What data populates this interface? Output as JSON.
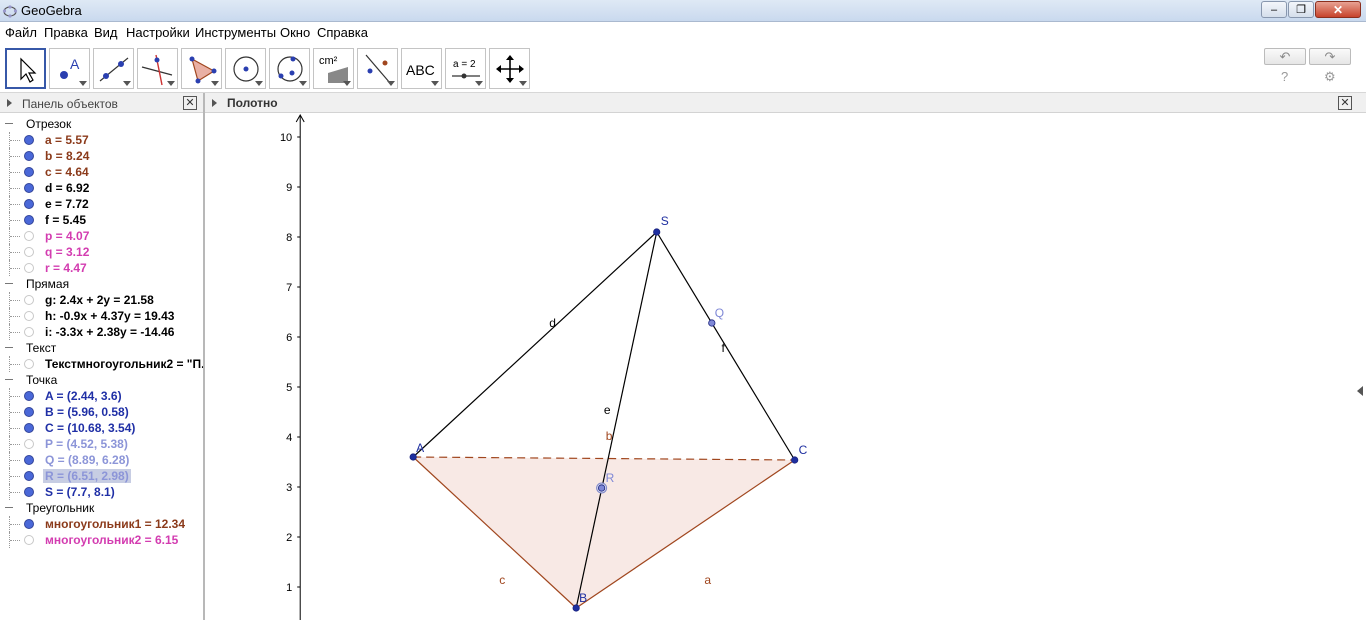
{
  "window": {
    "title": "GeoGebra",
    "controls": {
      "minimize": "–",
      "maximize": "❐",
      "close": "✕"
    }
  },
  "menu": [
    "Файл",
    "Правка",
    "Вид",
    "Настройки",
    "Инструменты",
    "Окно",
    "Справка"
  ],
  "toolbar": {
    "tools": [
      {
        "name": "move-tool",
        "icon": "arrow-pointer-icon",
        "selected": true
      },
      {
        "name": "point-tool",
        "icon": "point-icon",
        "label": "A"
      },
      {
        "name": "line-tool",
        "icon": "line-through-points-icon"
      },
      {
        "name": "perpendicular-tool",
        "icon": "perpendicular-line-icon"
      },
      {
        "name": "polygon-tool",
        "icon": "polygon-icon"
      },
      {
        "name": "circle-tool",
        "icon": "circle-center-point-icon"
      },
      {
        "name": "conic-tool",
        "icon": "circle-three-points-icon"
      },
      {
        "name": "measure-tool",
        "icon": "area-icon",
        "label": "cm²"
      },
      {
        "name": "reflect-tool",
        "icon": "reflect-line-icon"
      },
      {
        "name": "text-tool",
        "icon": "text-icon",
        "label": "ABC"
      },
      {
        "name": "slider-tool",
        "icon": "slider-icon",
        "label": "a = 2"
      },
      {
        "name": "move-view-tool",
        "icon": "move-graphics-view-icon"
      }
    ],
    "undo": "↶",
    "redo": "↷",
    "help": "?",
    "settings": "⚙"
  },
  "algebra_view": {
    "title": "Панель объектов",
    "close": "✕",
    "categories": [
      {
        "label": "Отрезок",
        "items": [
          {
            "text": "a = 5.57",
            "color": "#8b3a1a",
            "visible": true
          },
          {
            "text": "b = 8.24",
            "color": "#8b3a1a",
            "visible": true
          },
          {
            "text": "c = 4.64",
            "color": "#8b3a1a",
            "visible": true
          },
          {
            "text": "d = 6.92",
            "color": "#000000",
            "visible": true
          },
          {
            "text": "e = 7.72",
            "color": "#000000",
            "visible": true
          },
          {
            "text": "f = 5.45",
            "color": "#000000",
            "visible": true
          },
          {
            "text": "p = 4.07",
            "color": "#d33cb0",
            "visible": false
          },
          {
            "text": "q = 3.12",
            "color": "#d33cb0",
            "visible": false
          },
          {
            "text": "r = 4.47",
            "color": "#d33cb0",
            "visible": false
          }
        ]
      },
      {
        "label": "Прямая",
        "items": [
          {
            "text": "g: 2.4x + 2y = 21.58",
            "color": "#000000",
            "visible": false
          },
          {
            "text": "h: -0.9x + 4.37y = 19.43",
            "color": "#000000",
            "visible": false
          },
          {
            "text": "i: -3.3x + 2.38y = -14.46",
            "color": "#000000",
            "visible": false
          }
        ]
      },
      {
        "label": "Текст",
        "items": [
          {
            "text": "Текстмногоугольник2 = \"П...",
            "color": "#000000",
            "visible": false
          }
        ]
      },
      {
        "label": "Точка",
        "items": [
          {
            "text": "A = (2.44, 3.6)",
            "color": "#1f2fa6",
            "visible": true
          },
          {
            "text": "B = (5.96, 0.58)",
            "color": "#1f2fa6",
            "visible": true
          },
          {
            "text": "C = (10.68, 3.54)",
            "color": "#1f2fa6",
            "visible": true
          },
          {
            "text": "P = (4.52, 5.38)",
            "color": "#8c95d8",
            "visible": false
          },
          {
            "text": "Q = (8.89, 6.28)",
            "color": "#8c95d8",
            "visible": true
          },
          {
            "text": "R = (6.51, 2.98)",
            "color": "#8c95d8",
            "visible": true,
            "highlighted": true
          },
          {
            "text": "S = (7.7, 8.1)",
            "color": "#1f2fa6",
            "visible": true
          }
        ]
      },
      {
        "label": "Треугольник",
        "items": [
          {
            "text": "многоугольник1 = 12.34",
            "color": "#8b3a1a",
            "visible": true
          },
          {
            "text": "многоугольник2 = 6.15",
            "color": "#d33cb0",
            "visible": false
          }
        ]
      }
    ]
  },
  "graphics_view": {
    "title": "Полотно",
    "close": "✕",
    "y_axis_ticks": [
      "1",
      "2",
      "3",
      "4",
      "5",
      "6",
      "7",
      "8",
      "9",
      "10"
    ],
    "points": [
      {
        "label": "A",
        "x": 2.44,
        "y": 3.6
      },
      {
        "label": "B",
        "x": 5.96,
        "y": 0.58
      },
      {
        "label": "C",
        "x": 10.68,
        "y": 3.54
      },
      {
        "label": "S",
        "x": 7.7,
        "y": 8.1
      },
      {
        "label": "Q",
        "x": 8.89,
        "y": 6.28
      },
      {
        "label": "R",
        "x": 6.51,
        "y": 2.98
      }
    ],
    "segment_labels": [
      "a",
      "b",
      "c",
      "d",
      "e",
      "f"
    ],
    "colors": {
      "polygon_fill": "#f6e4de",
      "polygon_edge": "#a0461e",
      "point": "#1e2fa0",
      "point_light": "#7f88d6"
    }
  }
}
